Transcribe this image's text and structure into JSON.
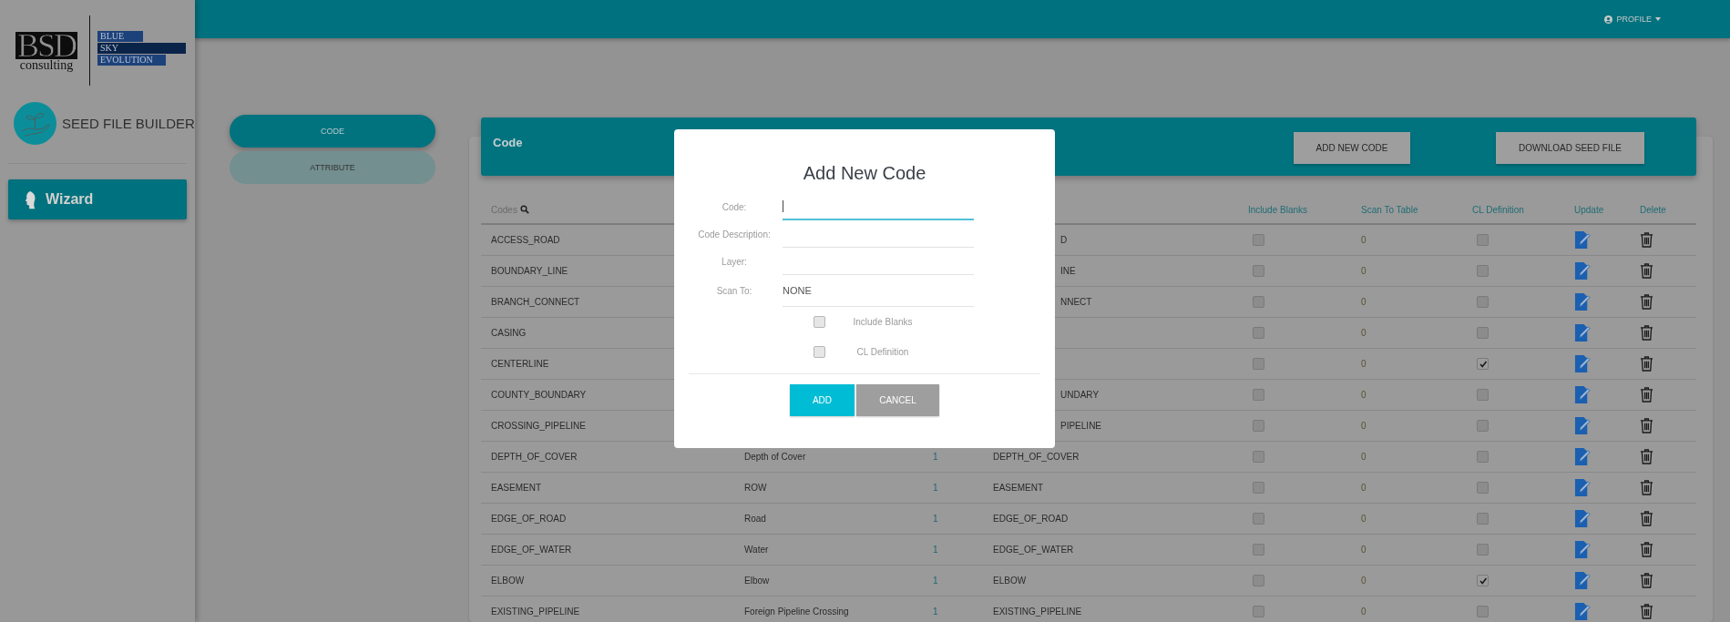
{
  "logo": {
    "mark": "BSD",
    "sub": "consulting",
    "tagline": [
      "BLUE",
      "SKY",
      "EVOLUTION"
    ]
  },
  "app": {
    "title": "SEED FILE BUILDER"
  },
  "sidebar": {
    "items": [
      {
        "label": "Wizard",
        "selected": true
      }
    ]
  },
  "topbar": {
    "profile": "PROFILE"
  },
  "tabs": [
    {
      "label": "CODE",
      "selected": true
    },
    {
      "label": "ATTRIBUTE",
      "selected": false
    }
  ],
  "card": {
    "title": "Code",
    "buttons": [
      "ADD NEW CODE",
      "DOWNLOAD SEED FILE"
    ]
  },
  "table": {
    "columns": [
      "Codes",
      "Include Blanks",
      "Scan To Table",
      "CL Definition",
      "Update",
      "Delete"
    ],
    "rows": [
      {
        "kind": "partly_hidden",
        "code": "ACCESS_ROAD",
        "layer": "D",
        "include_blanks": false,
        "scan_to": "0",
        "cl_definition": false
      },
      {
        "kind": "partly_hidden",
        "code": "BOUNDARY_LINE",
        "layer": "INE",
        "include_blanks": false,
        "scan_to": "0",
        "cl_definition": false
      },
      {
        "kind": "partly_hidden",
        "code": "BRANCH_CONNECT",
        "layer": "NNECT",
        "include_blanks": false,
        "scan_to": "0",
        "cl_definition": false
      },
      {
        "kind": "partly_hidden",
        "code": "CASING",
        "include_blanks": false,
        "scan_to": "0",
        "cl_definition": false
      },
      {
        "kind": "partly_hidden",
        "code": "CENTERLINE",
        "include_blanks": false,
        "scan_to": "0",
        "cl_definition": true
      },
      {
        "kind": "partly_hidden",
        "code": "COUNTY_BOUNDARY",
        "layer": "UNDARY",
        "include_blanks": false,
        "scan_to": "0",
        "cl_definition": false
      },
      {
        "kind": "partly_hidden",
        "code": "CROSSING_PIPELINE",
        "layer": "PIPELINE",
        "include_blanks": false,
        "scan_to": "0",
        "cl_definition": false
      },
      {
        "kind": "full",
        "code": "DEPTH_OF_COVER",
        "description": "Depth of Cover",
        "count": "1",
        "layer": "DEPTH_OF_COVER",
        "include_blanks": false,
        "scan_to": "0",
        "cl_definition": false
      },
      {
        "kind": "full",
        "code": "EASEMENT",
        "description": "ROW",
        "count": "1",
        "layer": "EASEMENT",
        "include_blanks": false,
        "scan_to": "0",
        "cl_definition": false
      },
      {
        "kind": "full",
        "code": "EDGE_OF_ROAD",
        "description": "Road",
        "count": "1",
        "layer": "EDGE_OF_ROAD",
        "include_blanks": false,
        "scan_to": "0",
        "cl_definition": false
      },
      {
        "kind": "full",
        "code": "EDGE_OF_WATER",
        "description": "Water",
        "count": "1",
        "layer": "EDGE_OF_WATER",
        "include_blanks": false,
        "scan_to": "0",
        "cl_definition": false
      },
      {
        "kind": "full",
        "code": "ELBOW",
        "description": "Elbow",
        "count": "1",
        "layer": "ELBOW",
        "include_blanks": false,
        "scan_to": "0",
        "cl_definition": true
      },
      {
        "kind": "full",
        "code": "EXISTING_PIPELINE",
        "description": "Foreign Pipeline Crossing",
        "count": "1",
        "layer": "EXISTING_PIPELINE",
        "include_blanks": false,
        "scan_to": "0",
        "cl_definition": false
      }
    ]
  },
  "modal": {
    "title": "Add New Code",
    "fields": [
      {
        "label": "Code:",
        "focused": true
      },
      {
        "label": "Code Description:",
        "focused": false
      },
      {
        "label": "Layer:",
        "focused": false
      },
      {
        "label": "Scan To:",
        "value": "NONE",
        "focused": false
      }
    ],
    "checkboxes": [
      {
        "label": "Include Blanks",
        "checked": false
      },
      {
        "label": "CL Definition",
        "checked": false
      }
    ],
    "buttons": [
      {
        "label": "ADD",
        "kind": "primary"
      },
      {
        "label": "CANCEL",
        "kind": "secondary"
      }
    ]
  }
}
